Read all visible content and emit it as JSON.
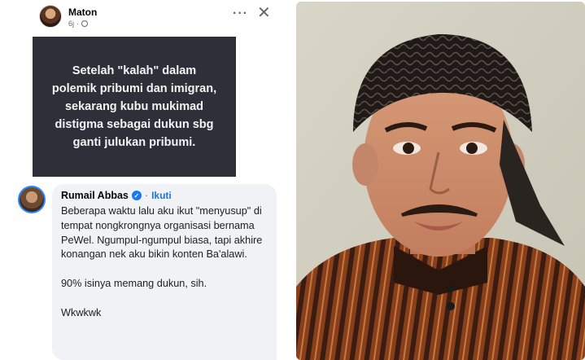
{
  "post": {
    "author": "Maton",
    "time": "6j",
    "more_icon": "···",
    "close_icon": "✕"
  },
  "image_card": {
    "text": "Setelah \"kalah\" dalam polemik pribumi dan imigran, sekarang kubu mukimad distigma sebagai dukun sbg ganti julukan pribumi."
  },
  "comment": {
    "author": "Rumail Abbas",
    "follow_label": "Ikuti",
    "separator": "·",
    "verified_icon": "✓",
    "text": "Beberapa waktu lalu aku ikut \"menyusup\" di tempat nongkrongnya organisasi bernama PeWel. Ngumpul-ngumpul biasa, tapi akhire konangan nek aku bikin konten Ba'alawi.\n\n90% isinya memang dukun, sih.\n\nWkwkwk"
  },
  "colors": {
    "accent": "#1877f2",
    "card_bg": "#2e3039",
    "bubble_bg": "#f0f2f5"
  }
}
